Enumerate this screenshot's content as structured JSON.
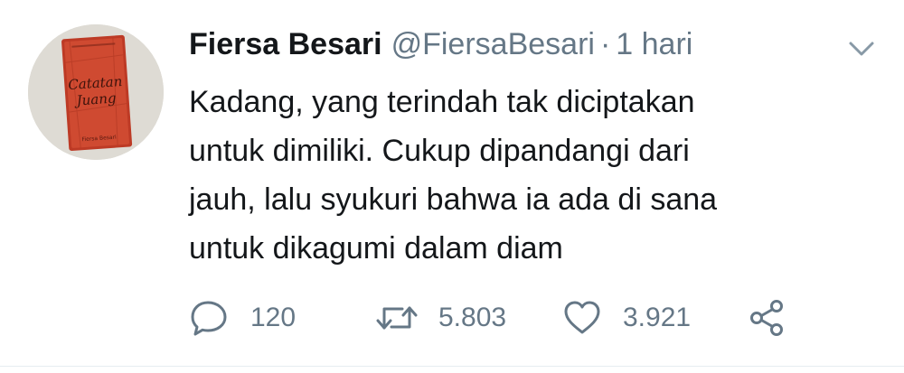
{
  "author": {
    "name": "Fiersa Besari",
    "handle": "@FiersaBesari",
    "separator": "·",
    "time": "1 hari",
    "avatar": {
      "book_title_line1": "Catatan",
      "book_title_line2": "Juang",
      "book_author": "Fiersa Besari"
    }
  },
  "tweet": {
    "lines": [
      "Kadang, yang terindah tak diciptakan",
      "untuk dimiliki. Cukup dipandangi dari",
      "jauh, lalu syukuri bahwa ia ada di sana",
      "untuk dikagumi dalam diam"
    ]
  },
  "actions": {
    "replies": "120",
    "retweets": "5.803",
    "likes": "3.921"
  },
  "icons": {
    "reply": "speech-bubble-icon",
    "retweet": "retweet-arrows-icon",
    "like": "heart-icon",
    "share": "share-nodes-icon",
    "menu": "chevron-down-icon"
  },
  "colors": {
    "name": "#14171a",
    "secondary": "#657786",
    "book_red": "#c9432c"
  }
}
